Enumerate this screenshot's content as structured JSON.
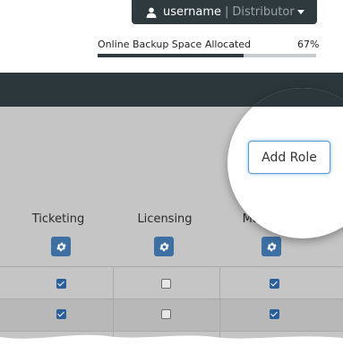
{
  "user_menu": {
    "username": "username",
    "separator": "|",
    "role": "Distributor"
  },
  "quota": {
    "label": "Online Backup Space Allocated",
    "percent_text": "67%",
    "percent_value": 0.67
  },
  "actions": {
    "add_role_label": "Add Role"
  },
  "columns": [
    {
      "label": "Ticketing"
    },
    {
      "label": "Licensing"
    },
    {
      "label": "Marketing"
    }
  ],
  "rows": [
    {
      "values": [
        true,
        false,
        true
      ]
    },
    {
      "values": [
        true,
        false,
        true
      ]
    },
    {
      "values": [
        true,
        true,
        true
      ]
    }
  ],
  "colors": {
    "dark": "#2c373b",
    "accent": "#3d6fa3",
    "checkbox_on": "#2a5f9a"
  },
  "icons": {
    "user": "person-icon",
    "menu": "caret-down-icon",
    "settings": "gear-icon"
  }
}
